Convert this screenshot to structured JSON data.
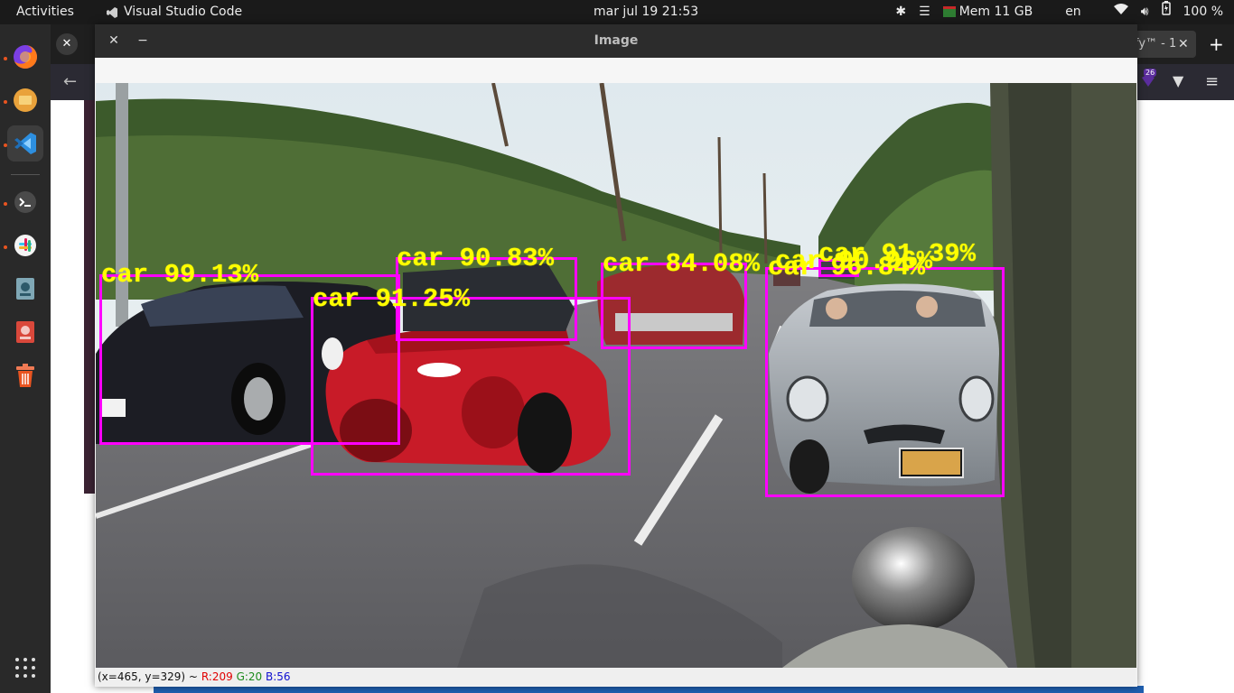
{
  "topbar": {
    "activities": "Activities",
    "app_name": "Visual Studio Code",
    "clock": "mar jul 19  21:53",
    "memory": "Mem 11 GB",
    "language": "en",
    "battery": "100 %"
  },
  "dock": {
    "apps": [
      "firefox-icon",
      "files-icon",
      "vscode-icon",
      "terminal-icon",
      "slack-icon",
      "image-viewer-icon",
      "document-viewer-icon",
      "trash-icon"
    ]
  },
  "browser_bg": {
    "tab_partial": "fy™ - 1",
    "badge_count": "26"
  },
  "image_window": {
    "title": "Image",
    "status": {
      "coords": "(x=465, y=329) ~",
      "r": "R:209",
      "g": "G:20",
      "b": "B:56"
    }
  },
  "detections": [
    {
      "label": "car 99.13%"
    },
    {
      "label": "car 91.25%"
    },
    {
      "label": "car 90.83%"
    },
    {
      "label": "car 84.08%"
    },
    {
      "label": "car 96.84%"
    },
    {
      "label": "car 91.39%"
    },
    {
      "label": "car 90.96%"
    }
  ],
  "colors": {
    "box": "#ff00ff",
    "label": "#ffff00",
    "accent": "#e95420"
  }
}
